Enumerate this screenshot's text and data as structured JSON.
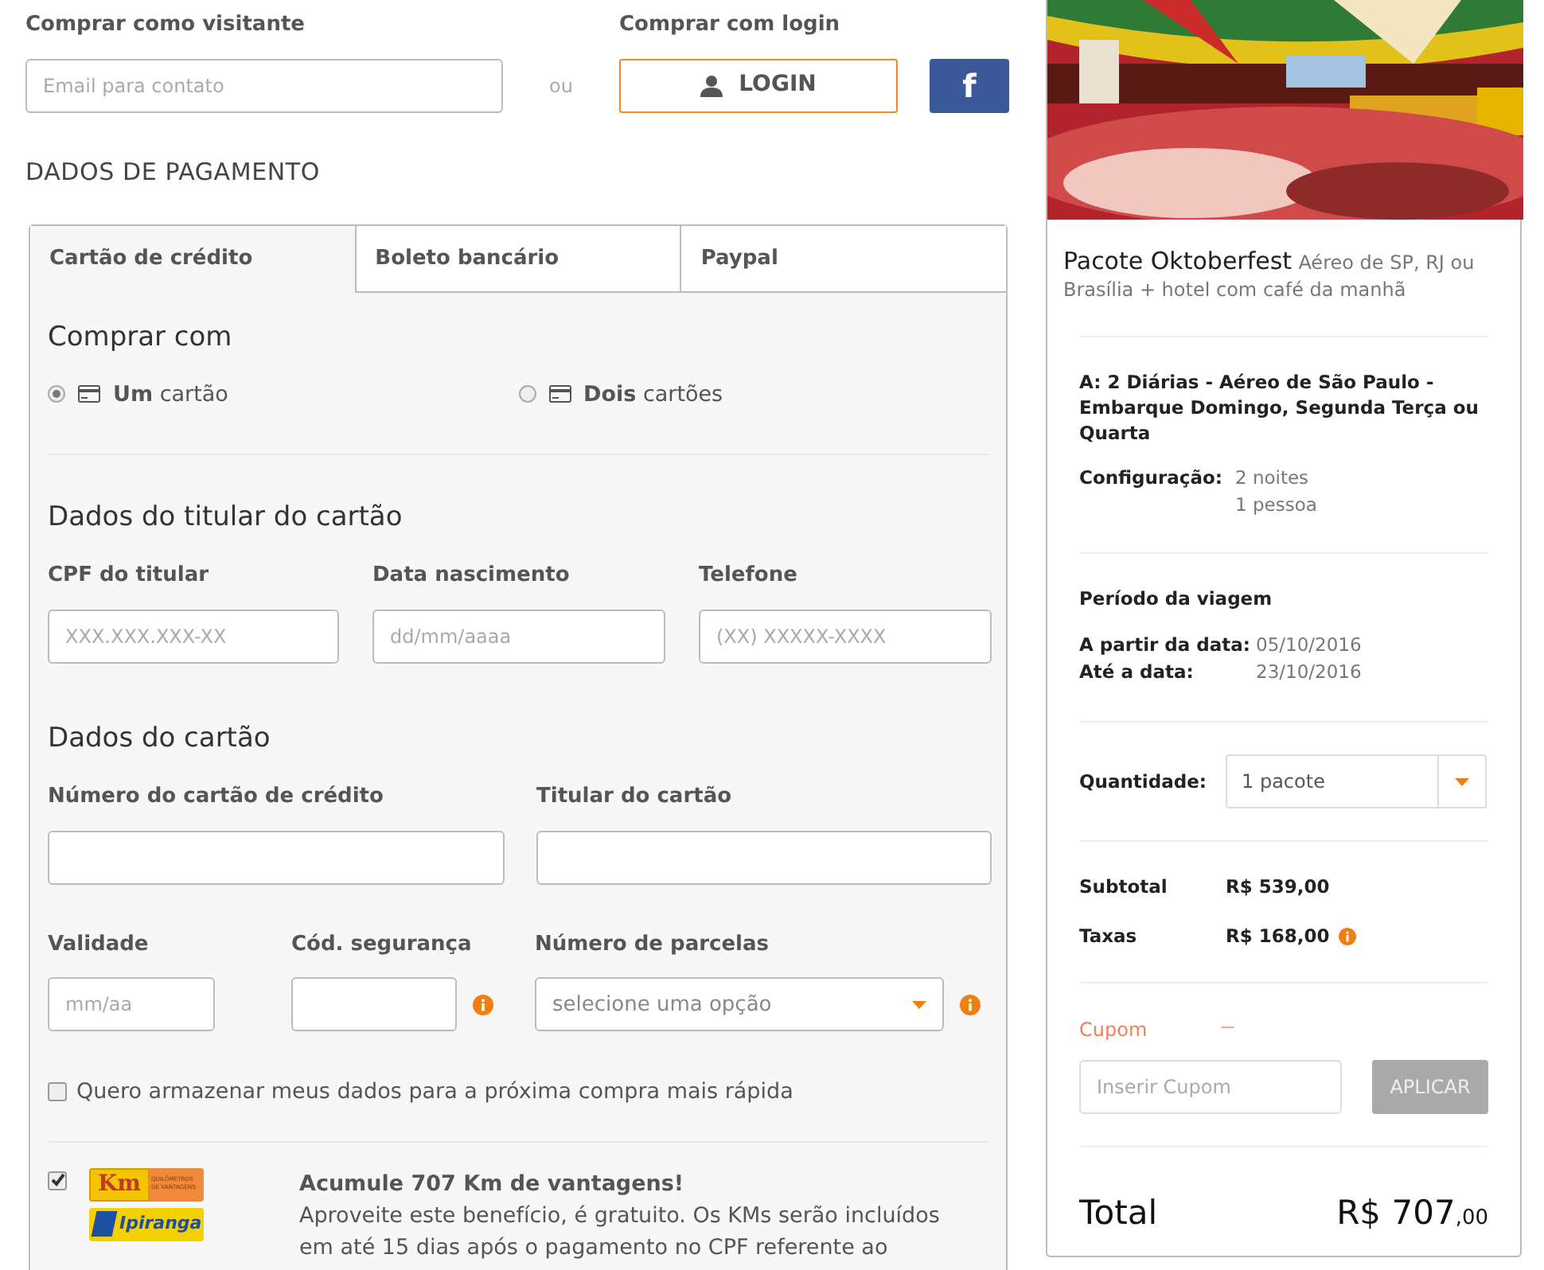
{
  "guest": {
    "heading": "Comprar como visitante",
    "email_placeholder": "Email para contato"
  },
  "separator": "ou",
  "login": {
    "heading": "Comprar com login",
    "button": "LOGIN",
    "facebook": "f"
  },
  "payment_heading": "DADOS DE PAGAMENTO",
  "tabs": [
    {
      "label": "Cartão de crédito",
      "selected": true
    },
    {
      "label": "Boleto bancário",
      "selected": false
    },
    {
      "label": "Paypal",
      "selected": false
    }
  ],
  "buy_with": {
    "title": "Comprar com",
    "options": [
      {
        "label": "**Um** cartão",
        "selected": true
      },
      {
        "label": "**Dois** cartões",
        "selected": false
      }
    ]
  },
  "holder": {
    "title": "Dados do titular do cartão",
    "fields": [
      {
        "label": "CPF do titular",
        "placeholder": "XXX.XXX.XXX-XX"
      },
      {
        "label": "Data nascimento",
        "placeholder": "dd/mm/aaaa"
      },
      {
        "label": "Telefone",
        "placeholder": "(XX) XXXXX-XXXX"
      }
    ]
  },
  "card": {
    "title": "Dados do cartão",
    "fields": [
      {
        "label": "Número do cartão de crédito"
      },
      {
        "label": "Titular do cartão"
      }
    ],
    "fields_row2": [
      {
        "label": "Validade",
        "kind": "input",
        "placeholder": "mm/aa",
        "info": false
      },
      {
        "label": "Cód. segurança",
        "kind": "input",
        "info": true
      },
      {
        "label": "Número de parcelas",
        "kind": "select",
        "placeholder": "selecione uma opção",
        "info": true
      }
    ]
  },
  "store_data": {
    "label": "Quero armazenar meus dados para a próxima compra mais rápida",
    "checked": false
  },
  "km": {
    "checked": true,
    "logo_km": "Km",
    "logo_km_sub": "QUILÔMETROS DE VANTAGENS",
    "logo_ipiranga": "Ipiranga",
    "title": "Acumule 707 Km de vantagens!",
    "text": "Aproveite este benefício, é gratuito. Os KMs serão incluídos em até 15 dias após o pagamento no CPF referente ao"
  },
  "summary": {
    "title": "Pacote Oktoberfest",
    "subtitle": [
      "Aéreo de SP, RJ ou",
      "Brasília + hotel com café da manhã"
    ],
    "option": "A: 2 Diárias - Aéreo de São Paulo - Embarque Domingo, Segunda Terça ou Quarta",
    "config_label": "Configuração:",
    "config_values": [
      "2 noites",
      "1 pessoa"
    ],
    "period_title": "Período da viagem",
    "dates": [
      {
        "label": "A partir da data:",
        "value": "05/10/2016"
      },
      {
        "label": "Até a data:",
        "value": "23/10/2016"
      }
    ],
    "quantity": {
      "label": "Quantidade:",
      "value": "1 pacote"
    },
    "lines": [
      {
        "label": "Subtotal",
        "value": "R$ 539,00",
        "info": false
      },
      {
        "label": "Taxas",
        "value": "R$ 168,00",
        "info": true
      }
    ],
    "coupon": {
      "label": "Cupom",
      "dash": "—",
      "placeholder": "Inserir Cupom",
      "button": "APLICAR"
    },
    "total": {
      "label": "Total",
      "amount": "R$ 707",
      "cents": ",00"
    }
  }
}
